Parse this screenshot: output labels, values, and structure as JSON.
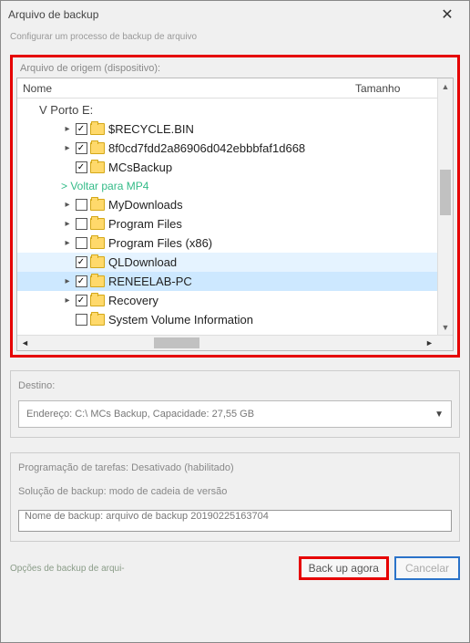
{
  "window": {
    "title": "Arquivo de backup",
    "subtitle": "Configurar um processo de backup de arquivo"
  },
  "source": {
    "group_label": "Arquivo de origem (dispositivo):",
    "col_name": "Nome",
    "col_size": "Tamanho",
    "root_label": "V Porto E:",
    "back_link": "> Voltar para MP4",
    "items": [
      {
        "label": "$RECYCLE.BIN",
        "checked": true,
        "expandable": true,
        "indent": 3,
        "selected": false
      },
      {
        "label": "8f0cd7fdd2a86906d042ebbbfaf1d668",
        "checked": true,
        "expandable": true,
        "indent": 3,
        "selected": false
      },
      {
        "label": "MCsBackup",
        "checked": true,
        "expandable": false,
        "indent": 3,
        "selected": false
      },
      {
        "label": "MyDownloads",
        "checked": false,
        "expandable": true,
        "indent": 3,
        "selected": false,
        "afterBacklink": true
      },
      {
        "label": "Program Files",
        "checked": false,
        "expandable": true,
        "indent": 3,
        "selected": false
      },
      {
        "label": "Program Files (x86)",
        "checked": false,
        "expandable": true,
        "indent": 3,
        "selected": false
      },
      {
        "label": "QLDownload",
        "checked": true,
        "expandable": false,
        "indent": 3,
        "selected": false,
        "hover": true
      },
      {
        "label": "RENEELAB-PC",
        "checked": true,
        "expandable": true,
        "indent": 3,
        "selected": true
      },
      {
        "label": "Recovery",
        "checked": true,
        "expandable": true,
        "indent": 3,
        "selected": false
      },
      {
        "label": "System Volume Information",
        "checked": false,
        "expandable": false,
        "indent": 3,
        "selected": false
      }
    ]
  },
  "destination": {
    "group_label": "Destino:",
    "value": "Endereço: C:\\ MCs Backup, Capacidade: 27,55 GB"
  },
  "schedule": {
    "line1_label": "Programação de tarefas:",
    "line1_value": "Desativado (habilitado)",
    "line2_label": "Solução de backup:",
    "line2_value": "modo de cadeia de versão",
    "name_label": "Nome de backup:",
    "name_value": "arquivo de backup 20190225163704"
  },
  "footer": {
    "options_link": "Opções de backup de arqui-",
    "primary_btn": "Back up agora",
    "cancel_btn": "Cancelar"
  }
}
